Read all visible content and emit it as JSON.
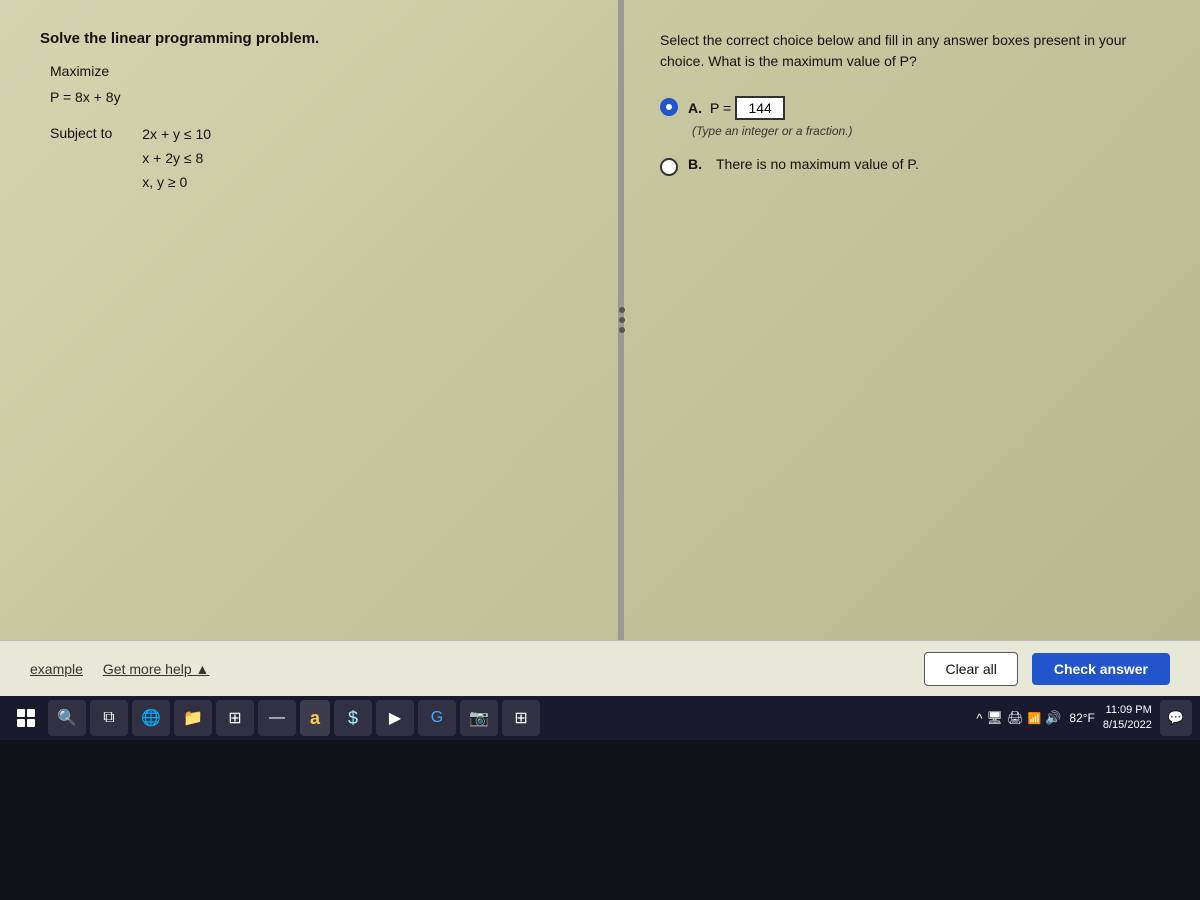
{
  "left": {
    "title": "Solve the linear programming problem.",
    "maximize_label": "Maximize",
    "objective": "P = 8x + 8y",
    "subject_label": "Subject to",
    "constraints": [
      "2x + y ≤ 10",
      "x + 2y ≤ 8",
      "x, y ≥ 0"
    ]
  },
  "right": {
    "question": "Select the correct choice below and fill in any answer boxes present in your choice. What is the maximum value of P?",
    "choices": [
      {
        "id": "A",
        "label": "A.",
        "selected": true,
        "p_equals": "P =",
        "answer_value": "144",
        "hint": "(Type an integer or a fraction.)"
      },
      {
        "id": "B",
        "label": "B.",
        "selected": false,
        "text": "There is no maximum value of P."
      }
    ]
  },
  "toolbar": {
    "example_label": "example",
    "get_more_help_label": "Get more help ▲",
    "clear_all_label": "Clear all",
    "check_answer_label": "Check answer"
  },
  "taskbar": {
    "temperature": "82°F",
    "time": "11:09 PM",
    "date": "8/15/2022"
  }
}
